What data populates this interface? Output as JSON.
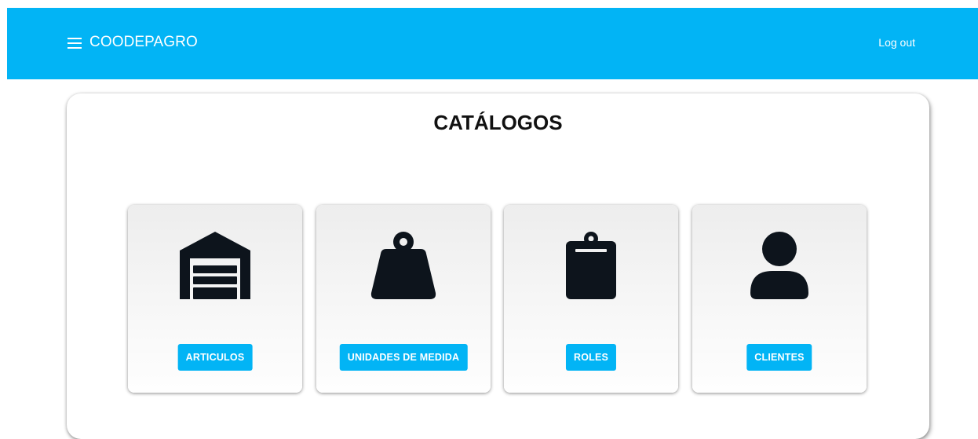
{
  "header": {
    "brand": "COODEPAGRO",
    "menu_icon": "hamburger-icon",
    "logout_label": "Log out",
    "accent_color": "#02b4f5"
  },
  "main": {
    "title": "CATÁLOGOS",
    "cards": [
      {
        "icon": "warehouse-icon",
        "button_label": "ARTICULOS"
      },
      {
        "icon": "weight-icon",
        "button_label": "UNIDADES DE MEDIDA"
      },
      {
        "icon": "clipboard-icon",
        "button_label": "ROLES"
      },
      {
        "icon": "user-icon",
        "button_label": "CLIENTES"
      }
    ]
  }
}
